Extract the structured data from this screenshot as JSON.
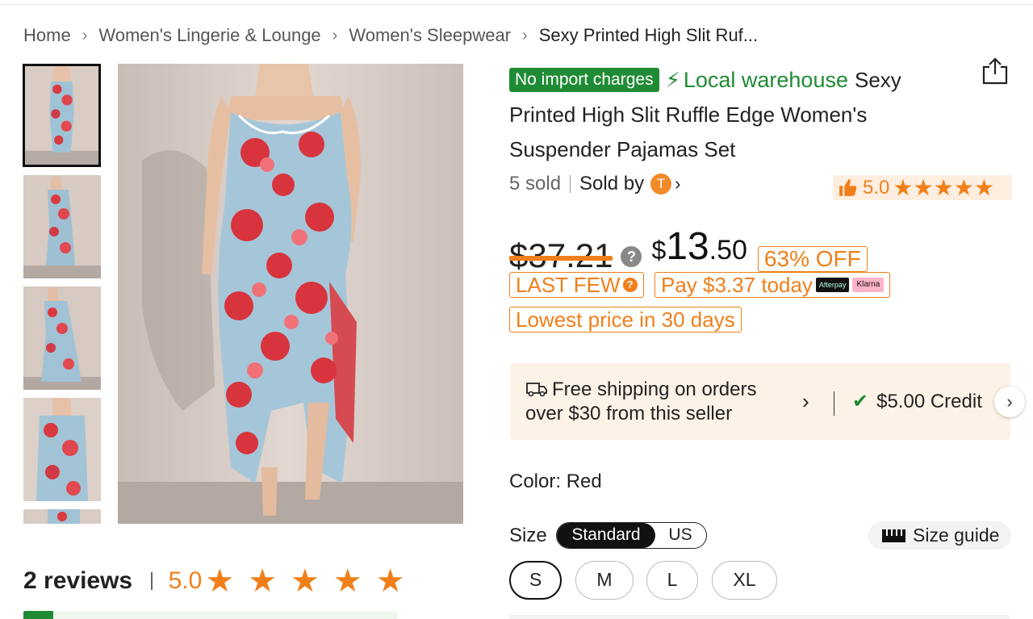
{
  "breadcrumb": {
    "items": [
      "Home",
      "Women's Lingerie & Lounge",
      "Women's Sleepwear"
    ],
    "current": "Sexy Printed High Slit Ruf..."
  },
  "product": {
    "badge": "No import charges",
    "local_label": "Local warehouse",
    "title": "Sexy Printed High Slit Ruffle Edge Women's Suspender Pajamas Set",
    "sold": "5 sold",
    "sold_by": "Sold by",
    "store_initial": "T",
    "rating": "5.0",
    "rating_stars": 5
  },
  "price": {
    "original": "$37.21",
    "currency": "$",
    "integer": "13",
    "decimal": ".50",
    "discount": "63% OFF",
    "tags": {
      "last_few": "LAST FEW",
      "pay_today": "Pay $3.37 today",
      "afterpay": "Afterpay",
      "klarna": "Klarna",
      "lowest": "Lowest price in 30 days"
    }
  },
  "shipping": {
    "line1": "Free shipping on orders",
    "line2": "over $30 from this seller",
    "credit": "$5.00 Credit"
  },
  "color": {
    "label": "Color: Red"
  },
  "size": {
    "label": "Size",
    "systems": [
      "Standard",
      "US"
    ],
    "selected_system": "Standard",
    "guide": "Size guide",
    "options": [
      "S",
      "M",
      "L",
      "XL"
    ],
    "selected": "S"
  },
  "reviews": {
    "count": "2 reviews",
    "score": "5.0",
    "stars": 5
  },
  "colors": {
    "accent": "#f07f1a",
    "green": "#1f8b34",
    "shipping_bg": "#fdf2e6"
  },
  "icons": [
    "share-icon",
    "bolt-icon",
    "help-icon",
    "truck-icon",
    "check-icon",
    "ruler-icon",
    "star-icon",
    "chevron-right-icon"
  ]
}
